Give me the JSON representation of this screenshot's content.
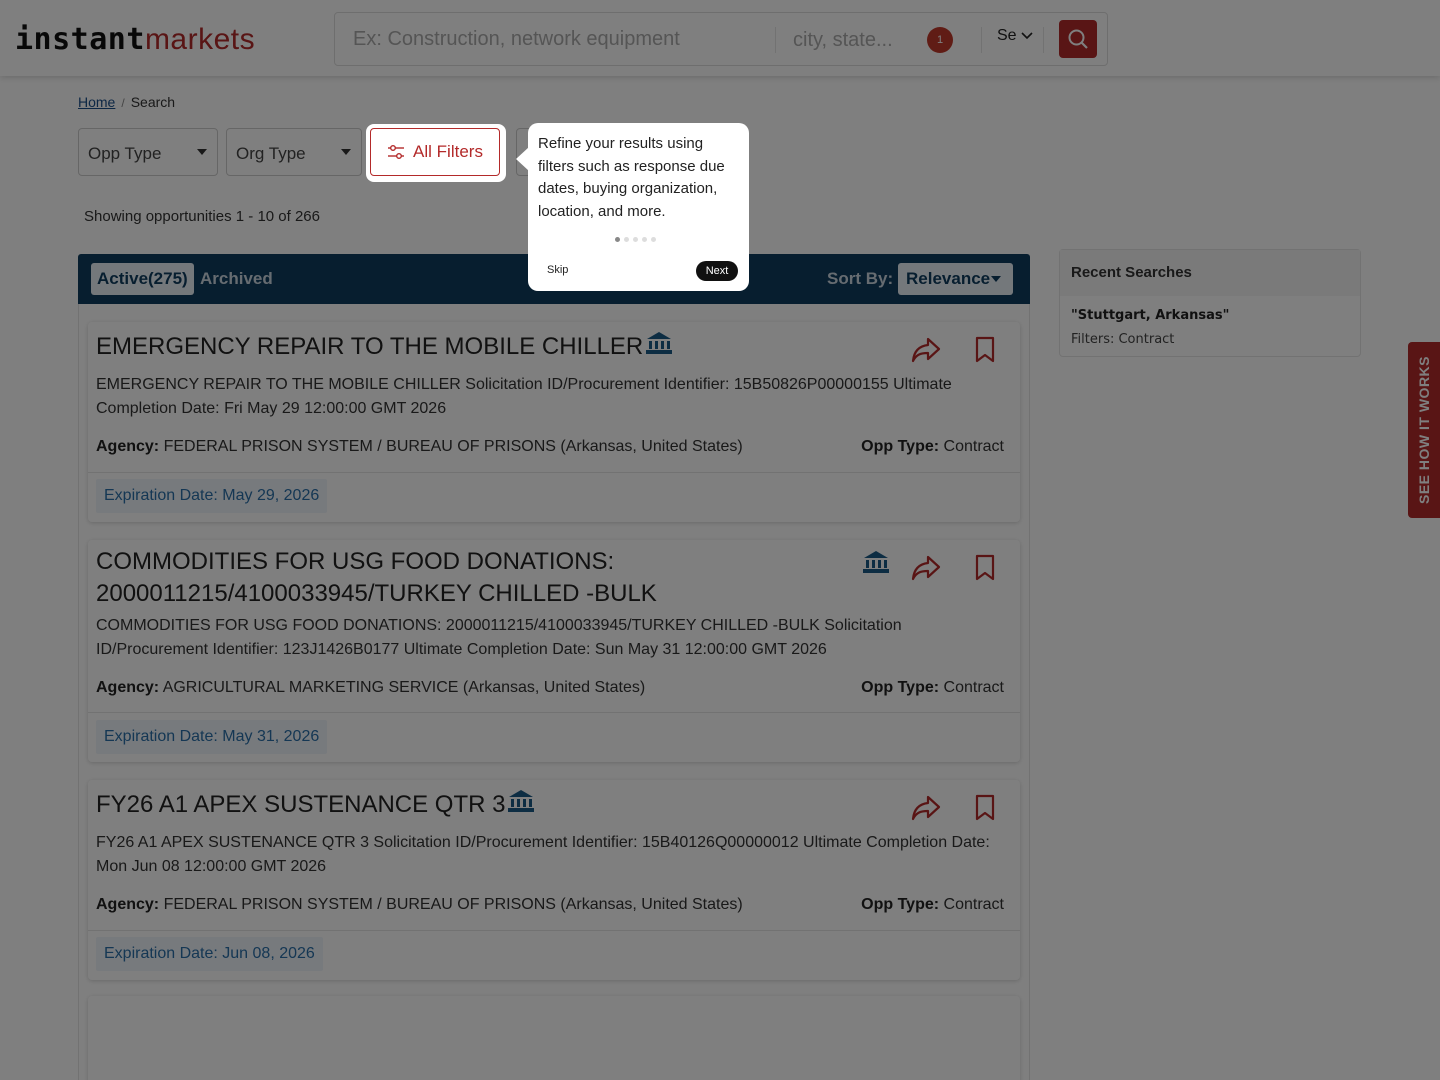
{
  "header": {
    "logo_part1": "instant",
    "logo_part2": "markets",
    "keyword_placeholder": "Ex: Construction, network equipment",
    "location_placeholder": "city, state...",
    "location_badge": "1",
    "select_label": "Se"
  },
  "breadcrumb": {
    "home": "Home",
    "current": "Search"
  },
  "filters": {
    "opp_type": "Opp Type",
    "org_type": "Org Type",
    "all_filters": "All Filters"
  },
  "showing": "Showing opportunities 1 - 10 of 266",
  "tabs": {
    "active": "Active(275)",
    "archived": "Archived",
    "sort_label": "Sort By:",
    "sort_value": "Relevance"
  },
  "results": [
    {
      "title": "EMERGENCY REPAIR TO THE MOBILE CHILLER",
      "description": "EMERGENCY REPAIR TO THE MOBILE CHILLER Solicitation ID/Procurement Identifier: 15B50826P00000155 Ultimate Completion Date: Fri May 29 12:00:00 GMT 2026",
      "agency_label": "Agency:",
      "agency": "FEDERAL PRISON SYSTEM / BUREAU OF PRISONS (Arkansas, United States)",
      "opp_type_label": "Opp Type:",
      "opp_type": "Contract",
      "expiration": "Expiration Date:  May 29, 2026"
    },
    {
      "title_line1": "COMMODITIES FOR USG FOOD DONATIONS:",
      "title_line2": "2000011215/4100033945/TURKEY CHILLED -BULK",
      "description": "COMMODITIES FOR USG FOOD DONATIONS: 2000011215/4100033945/TURKEY CHILLED -BULK Solicitation ID/Procurement Identifier: 123J1426B0177 Ultimate Completion Date: Sun May 31 12:00:00 GMT 2026",
      "agency_label": "Agency:",
      "agency": "AGRICULTURAL MARKETING SERVICE (Arkansas, United States)",
      "opp_type_label": "Opp Type:",
      "opp_type": "Contract",
      "expiration": "Expiration Date:  May 31, 2026"
    },
    {
      "title": "FY26 A1 APEX SUSTENANCE QTR 3",
      "description": "FY26 A1 APEX SUSTENANCE QTR 3 Solicitation ID/Procurement Identifier: 15B40126Q00000012 Ultimate Completion Date: Mon Jun 08 12:00:00 GMT 2026",
      "agency_label": "Agency:",
      "agency": "FEDERAL PRISON SYSTEM / BUREAU OF PRISONS (Arkansas, United States)",
      "opp_type_label": "Opp Type:",
      "opp_type": "Contract",
      "expiration": "Expiration Date:  Jun 08, 2026"
    }
  ],
  "recent_searches": {
    "heading": "Recent Searches",
    "query": "\"Stuttgart, Arkansas\"",
    "filters": "Filters: Contract"
  },
  "side_tab": "SEE HOW IT WORKS",
  "tooltip": {
    "text": "Refine your results using filters such as response due dates, buying organization, location, and more.",
    "skip": "Skip",
    "next": "Next"
  },
  "colors": {
    "brand": "#b32a2a",
    "navy": "#0f3c5f",
    "link": "#2a6fa8"
  }
}
